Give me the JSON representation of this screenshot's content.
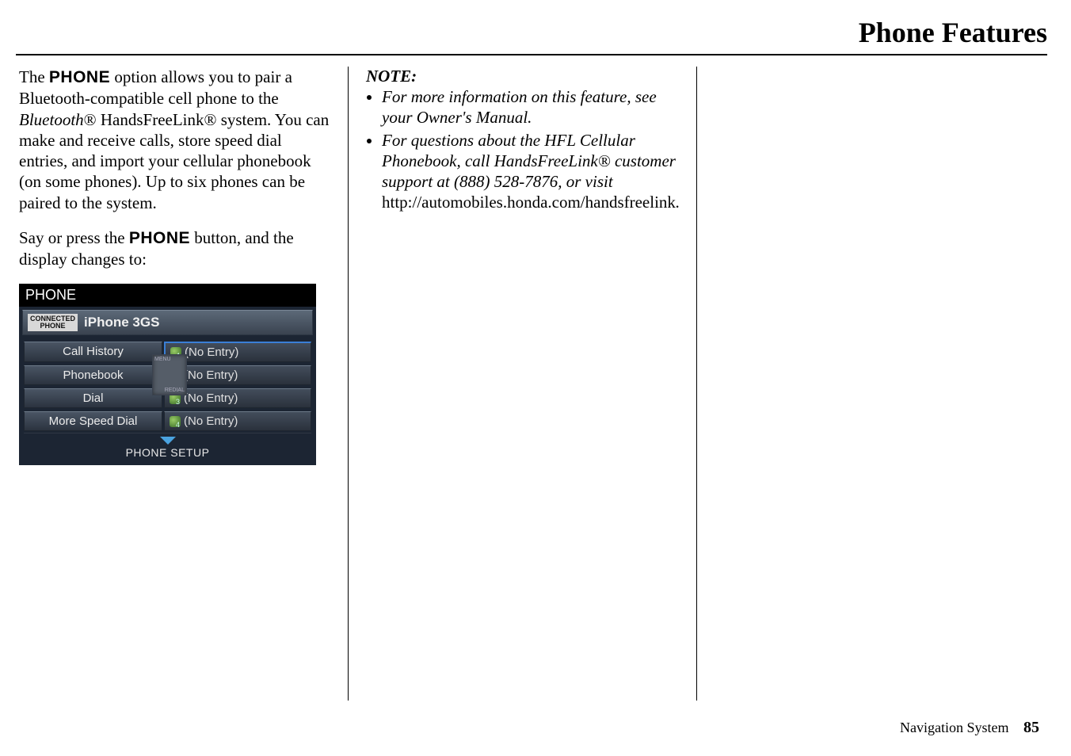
{
  "header": {
    "title": "Phone Features"
  },
  "col1": {
    "p1_pre": "The ",
    "p1_bold": "PHONE",
    "p1_post": " option allows you to pair a Bluetooth-compatible cell phone to the ",
    "p1_ital": "Bluetooth",
    "p1_after": "® HandsFreeLink® system. You can make and receive calls, store speed dial entries, and import your cellular phonebook (on some phones). Up to six phones can be paired to the system.",
    "p2_pre": "Say or press the ",
    "p2_bold": "PHONE",
    "p2_post": " button, and the display changes to:"
  },
  "phone": {
    "title": "PHONE",
    "conn_badge_l1": "CONNECTED",
    "conn_badge_l2": "PHONE",
    "conn_name": "iPhone 3GS",
    "left": [
      "Call History",
      "Phonebook",
      "Dial",
      "More Speed Dial"
    ],
    "right": [
      "(No Entry)",
      "(No Entry)",
      "(No Entry)",
      "(No Entry)"
    ],
    "subs": [
      "1",
      "2",
      "3",
      "4"
    ],
    "center_top": "MENU",
    "center_bot": "REDIAL",
    "bottom": "PHONE SETUP"
  },
  "col2": {
    "note_title": "NOTE:",
    "li1": "For more information on this feature, see your Owner's Manual.",
    "li2_ital": "For questions about the HFL Cellular Phonebook, call HandsFreeLink® customer support at (888) 528-7876, or visit ",
    "li2_plain": "http://automobiles.honda.com/handsfreelink",
    "li2_end": "."
  },
  "footer": {
    "label": "Navigation System",
    "page": "85"
  }
}
